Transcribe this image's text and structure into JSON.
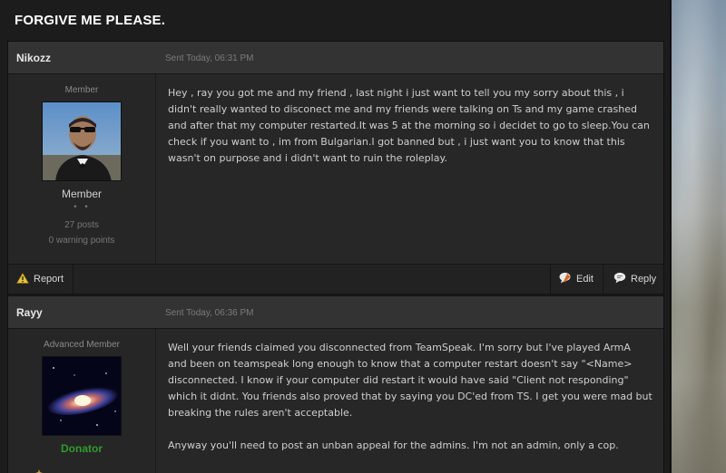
{
  "page": {
    "title": "FORGIVE ME PLEASE."
  },
  "posts": [
    {
      "author": "Nikozz",
      "date": "Sent Today, 06:31 PM",
      "rank_title": "Member",
      "group": "Member",
      "group_color": "#d0d0d0",
      "pips": "• •",
      "posts": "27 posts",
      "warnings": "0 warning points",
      "body": [
        "Hey , ray you got me and my friend , last night i just want to tell you my sorry about this , i didn't really wanted to disconect me and my friends were talking on Ts and my game crashed and after that my computer restarted.It was 5 at the morning so i decidet to go to sleep.You can check if you want to , im from Bulgarian.I got banned but , i just want you to know that this wasn't on purpose and i didn't want to ruin the roleplay."
      ],
      "report_label": "Report",
      "edit_label": "Edit",
      "reply_label": "Reply"
    },
    {
      "author": "Rayy",
      "date": "Sent Today, 06:36 PM",
      "rank_title": "Advanced Member",
      "group": "Donator",
      "group_color": "#2f9a2b",
      "body": [
        "Well your friends claimed you disconnected from TeamSpeak. I'm sorry but I've played ArmA and been on teamspeak long enough to know that a computer restart doesn't say \"<Name> disconnected. I know if your computer did restart it would have said \"Client not responding\" which it didnt. You friends also proved that by saying you DC'ed from TS. I get you were mad but breaking the rules aren't acceptable.",
        "Anyway you'll need to post an unban appeal for the admins. I'm not an admin, only a cop."
      ]
    }
  ],
  "icons": {
    "warning": "warning-icon",
    "edit": "edit-icon",
    "reply": "reply-icon"
  }
}
